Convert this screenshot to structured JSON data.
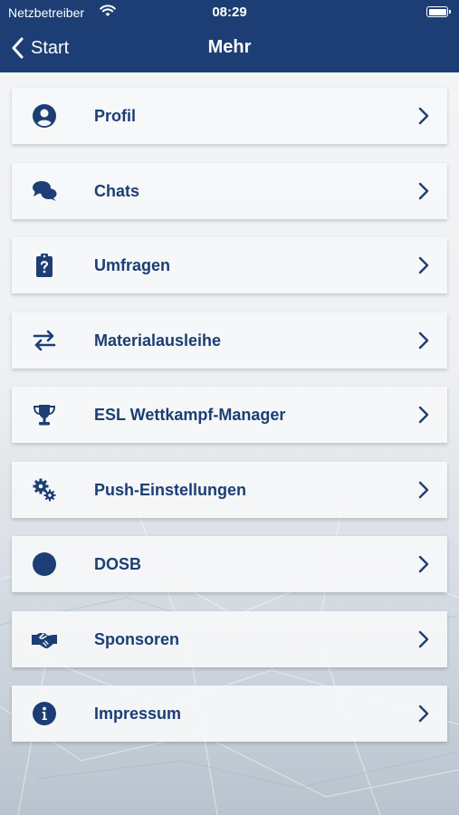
{
  "status_bar": {
    "carrier": "Netzbetreiber",
    "time": "08:29"
  },
  "nav": {
    "back_label": "Start",
    "title": "Mehr"
  },
  "colors": {
    "brand": "#1c3e74",
    "card": "#f6f7f9"
  },
  "menu": [
    {
      "label": "Profil",
      "icon": "user-circle-icon"
    },
    {
      "label": "Chats",
      "icon": "chat-bubbles-icon"
    },
    {
      "label": "Umfragen",
      "icon": "clipboard-question-icon"
    },
    {
      "label": "Materialausleihe",
      "icon": "exchange-arrows-icon"
    },
    {
      "label": "ESL Wettkampf-Manager",
      "icon": "trophy-icon"
    },
    {
      "label": "Push-Einstellungen",
      "icon": "gears-icon"
    },
    {
      "label": "DOSB",
      "icon": "circle-icon"
    },
    {
      "label": "Sponsoren",
      "icon": "handshake-icon"
    },
    {
      "label": "Impressum",
      "icon": "info-circle-icon"
    }
  ]
}
